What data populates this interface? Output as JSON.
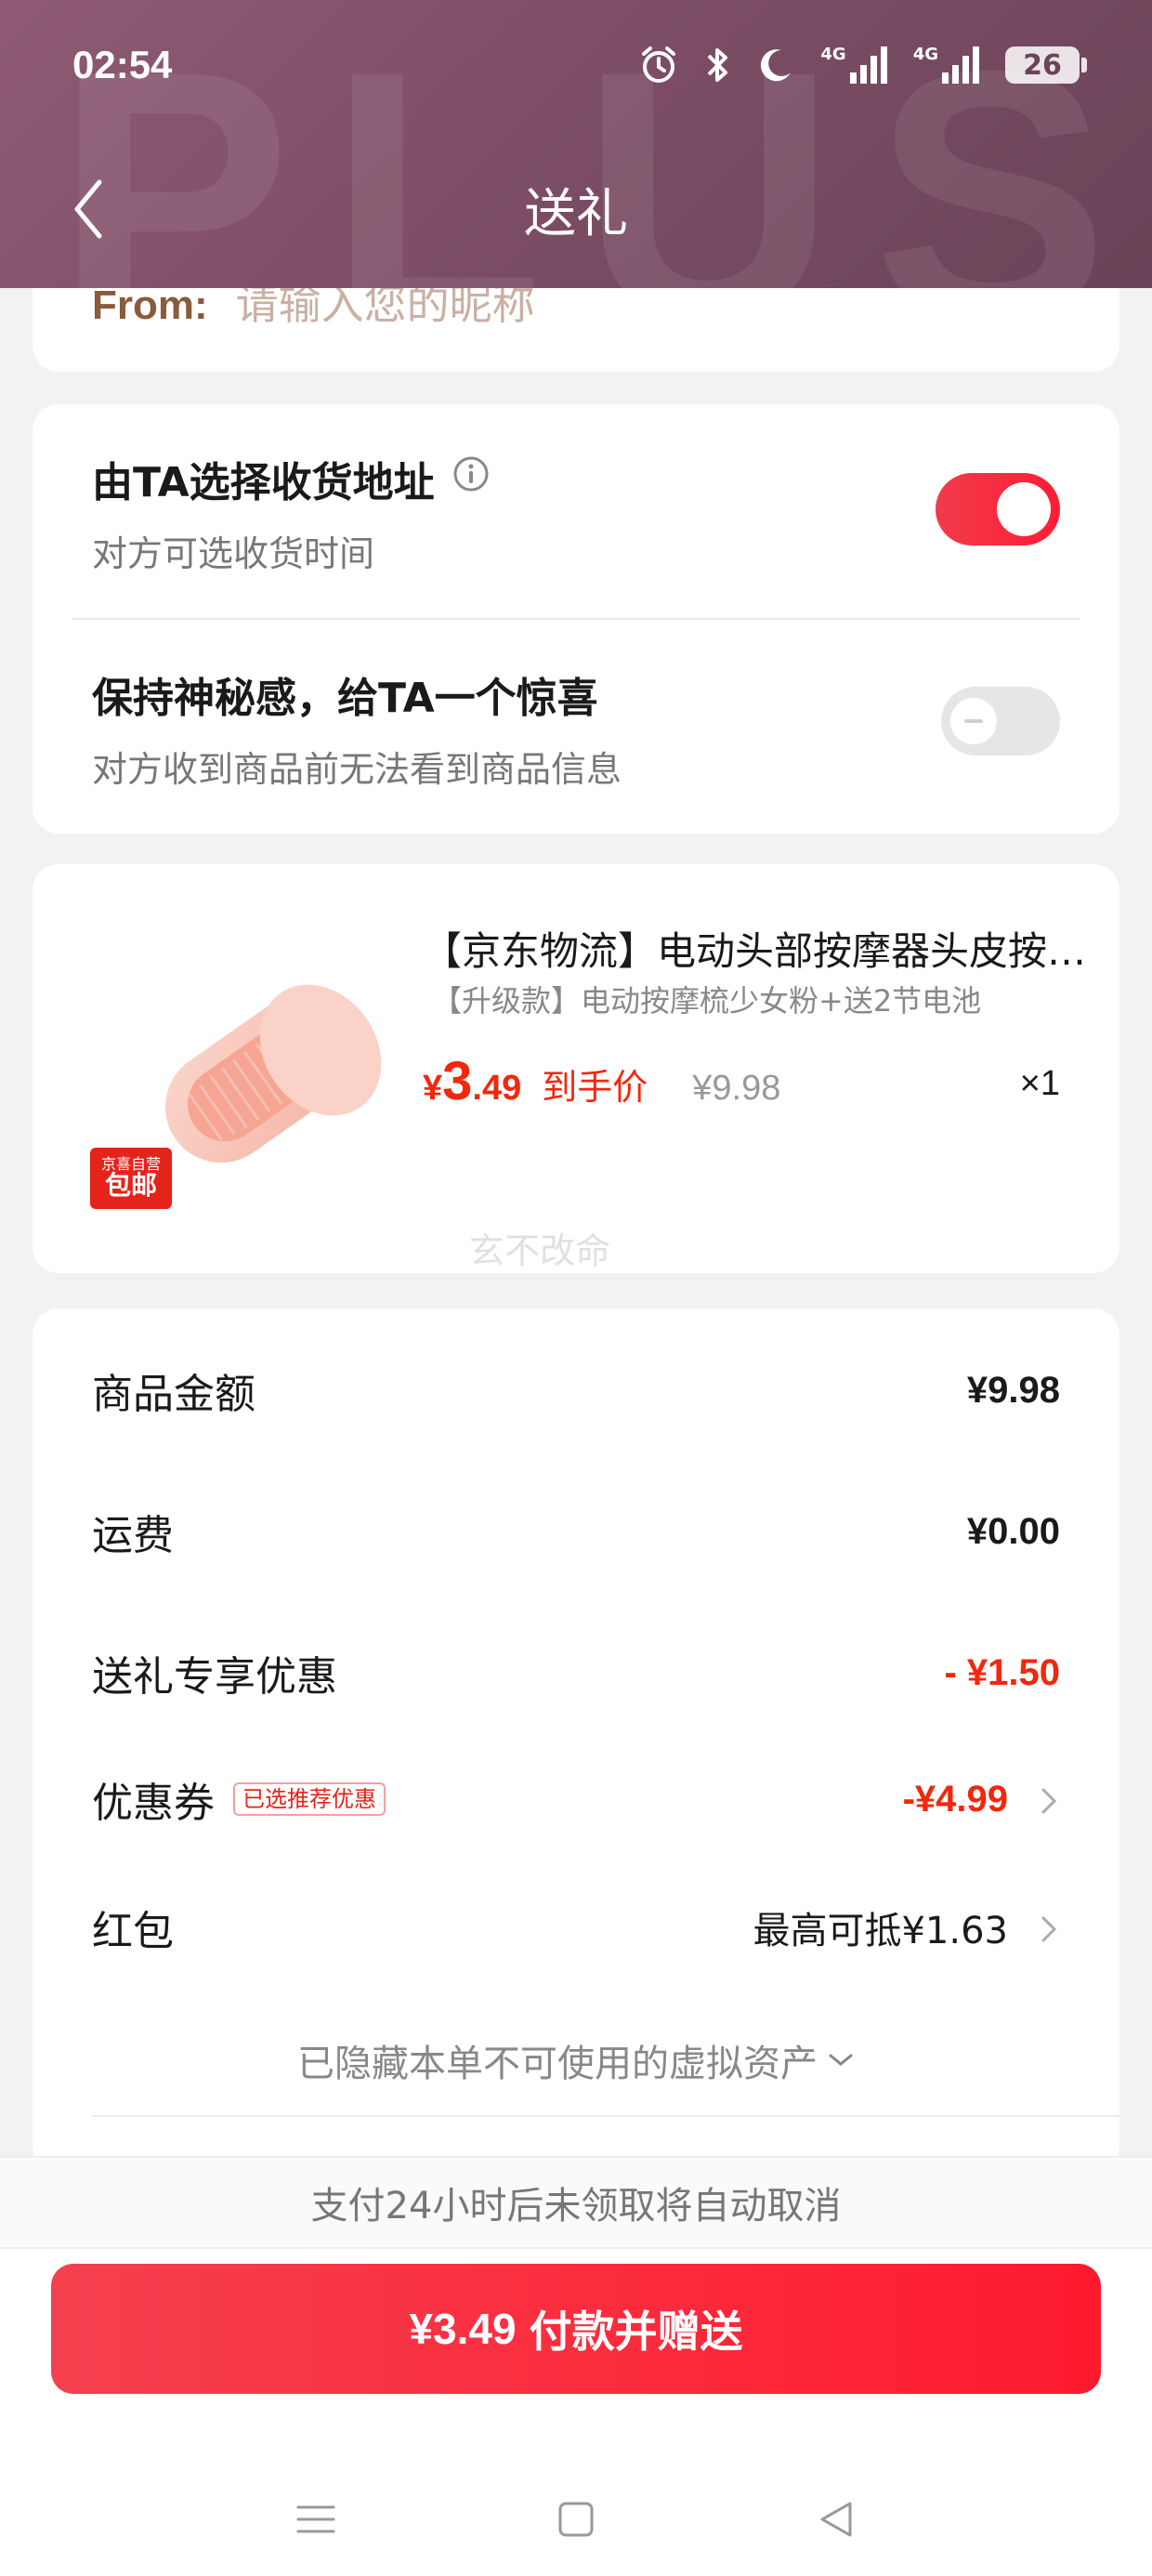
{
  "status_bar": {
    "time": "02:54",
    "icons": [
      "alarm-icon",
      "bluetooth-icon",
      "moon-icon",
      "signal-4g-icon",
      "signal-4g-icon"
    ],
    "signal_label_1": "4G",
    "signal_label_2": "4G",
    "battery": "26"
  },
  "header": {
    "watermark": "PLUS",
    "title": "送礼"
  },
  "from_card": {
    "label": "From:",
    "placeholder": "请输入您的昵称"
  },
  "options": [
    {
      "title": "由TA选择收货地址",
      "subtitle": "对方可选收货时间",
      "has_info_icon": true,
      "enabled": true
    },
    {
      "title": "保持神秘感，给TA一个惊喜",
      "subtitle": "对方收到商品前无法看到商品信息",
      "has_info_icon": false,
      "enabled": false
    }
  ],
  "product": {
    "title": "【京东物流】电动头部按摩器头皮按摩梳",
    "spec": "【升级款】电动按摩梳少女粉+送2节电池",
    "badge_top": "京喜自营",
    "badge_main": "包邮",
    "price_currency": "¥",
    "price_integer": "3",
    "price_decimal": ".49",
    "price_tag": "到手价",
    "original_price": "¥9.98",
    "quantity": "×1",
    "watermark": "玄不改命"
  },
  "summary": {
    "rows": [
      {
        "label": "商品金额",
        "value": "¥9.98"
      },
      {
        "label": "运费",
        "value": "¥0.00"
      },
      {
        "label": "送礼专享优惠",
        "value": "- ¥1.50"
      },
      {
        "label": "优惠券",
        "tag": "已选推荐优惠",
        "value": "-¥4.99"
      },
      {
        "label": "红包",
        "value": "最高可抵¥1.63"
      }
    ],
    "hidden_assets": "已隐藏本单不可使用的虚拟资产"
  },
  "bottom": {
    "notice": "支付24小时后未领取将自动取消",
    "pay_amount": "¥3.49",
    "pay_label": "付款并赠送"
  },
  "colors": {
    "header": "#7a4c63",
    "accent": "#f2270c",
    "button": "#ff1a2e"
  }
}
